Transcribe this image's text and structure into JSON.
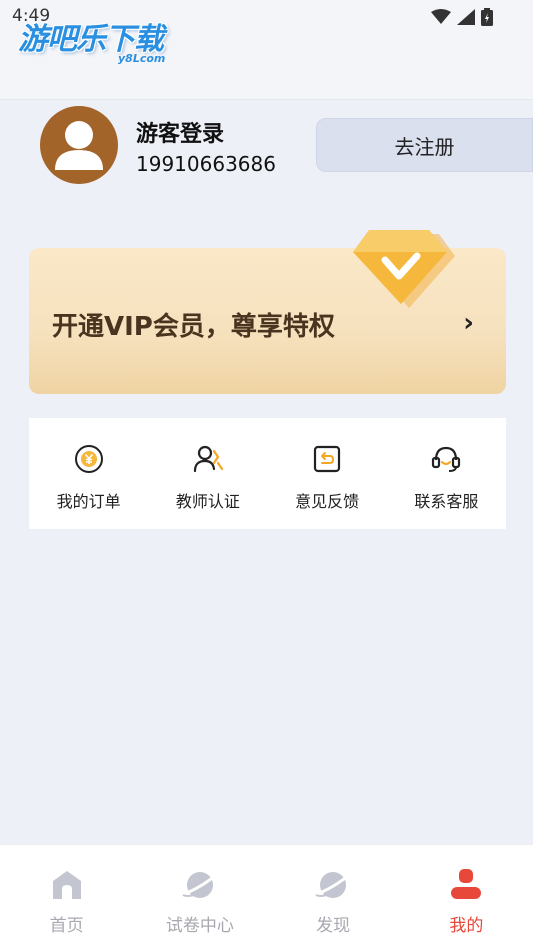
{
  "status_bar": {
    "time": "4:49"
  },
  "watermark": {
    "text": "游吧乐下载",
    "sub": "y8Lcom"
  },
  "profile": {
    "username": "游客登录",
    "phone": "19910663686",
    "register_label": "去注册"
  },
  "vip": {
    "text": "开通VIP会员，尊享特权",
    "arrow": "›"
  },
  "menu": {
    "items": [
      {
        "label": "我的订单",
        "icon": "yuan-coin-icon"
      },
      {
        "label": "教师认证",
        "icon": "teacher-icon"
      },
      {
        "label": "意见反馈",
        "icon": "feedback-icon"
      },
      {
        "label": "联系客服",
        "icon": "headset-icon"
      }
    ]
  },
  "tabbar": {
    "active_color": "#e8483a",
    "inactive_color": "#a8a8b0",
    "tabs": [
      {
        "label": "首页",
        "icon": "home-icon",
        "active": false
      },
      {
        "label": "试卷中心",
        "icon": "planet-icon",
        "active": false
      },
      {
        "label": "发现",
        "icon": "planet-icon",
        "active": false
      },
      {
        "label": "我的",
        "icon": "profile-icon",
        "active": true
      }
    ]
  }
}
